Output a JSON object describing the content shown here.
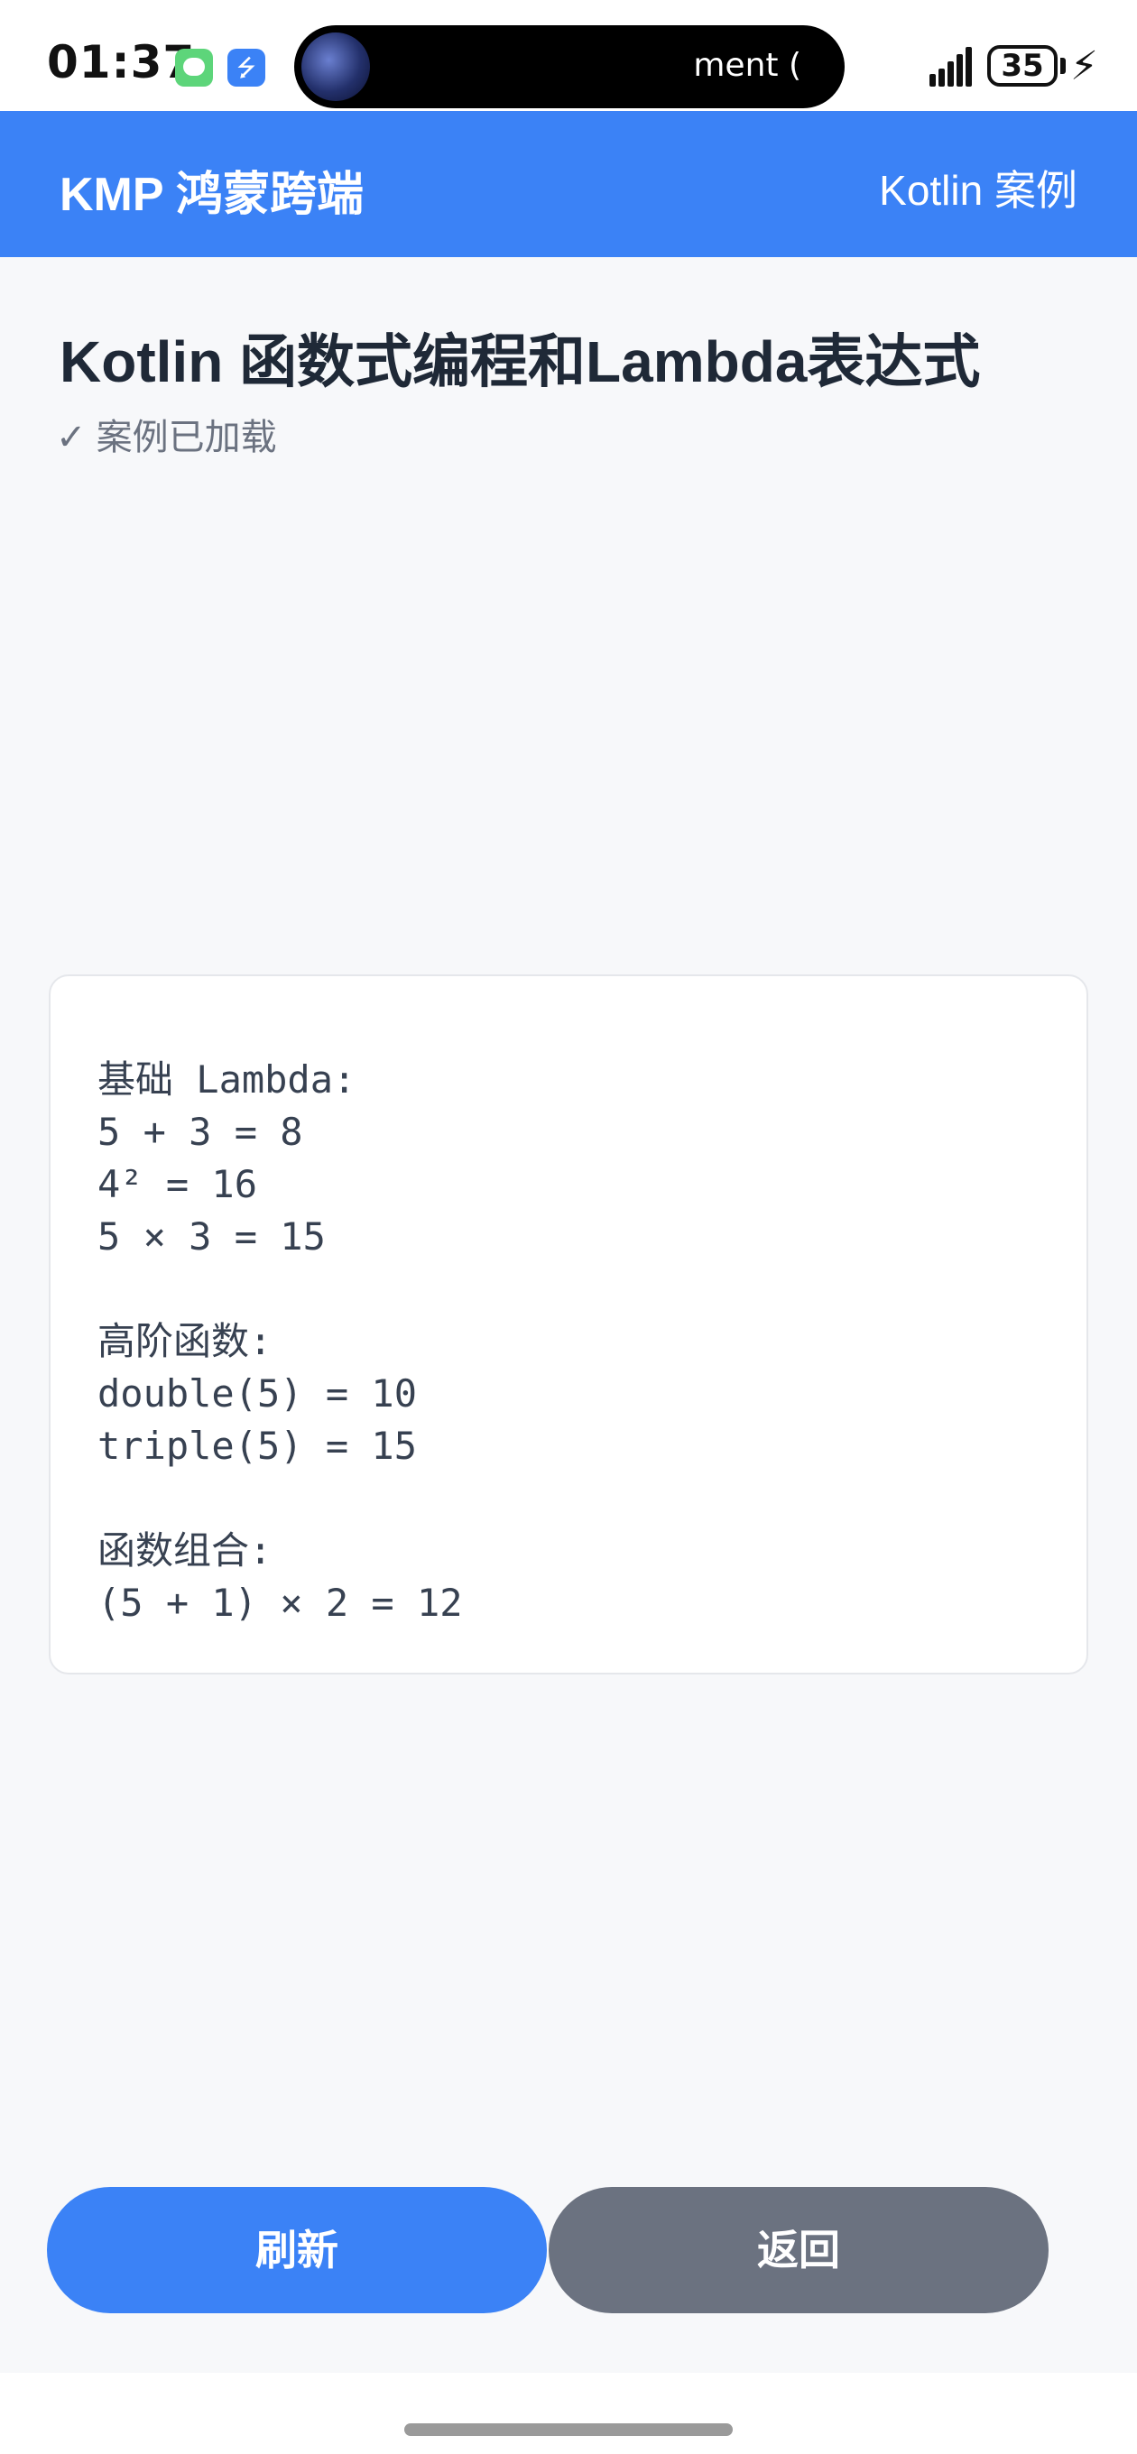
{
  "status_bar": {
    "time": "01:37",
    "island_text": "ment (",
    "battery": "35",
    "icons": [
      "chat-app-icon",
      "usb-icon",
      "signal-icon",
      "battery-icon",
      "charging-bolt-icon"
    ]
  },
  "app_bar": {
    "title": "KMP 鸿蒙跨端",
    "right_label": "Kotlin 案例"
  },
  "page": {
    "title": "Kotlin 函数式编程和Lambda表达式",
    "subtitle": "✓ 案例已加载"
  },
  "output": {
    "text": "基础 Lambda:\n5 + 3 = 8\n4² = 16\n5 × 3 = 15\n\n高阶函数:\ndouble(5) = 10\ntriple(5) = 15\n\n函数组合:\n(5 + 1) × 2 = 12"
  },
  "buttons": {
    "refresh_label": "刷新",
    "back_label": "返回"
  },
  "colors": {
    "accent": "#3b82f6",
    "secondary_button": "#6b7280",
    "background": "#f7f8fa"
  }
}
